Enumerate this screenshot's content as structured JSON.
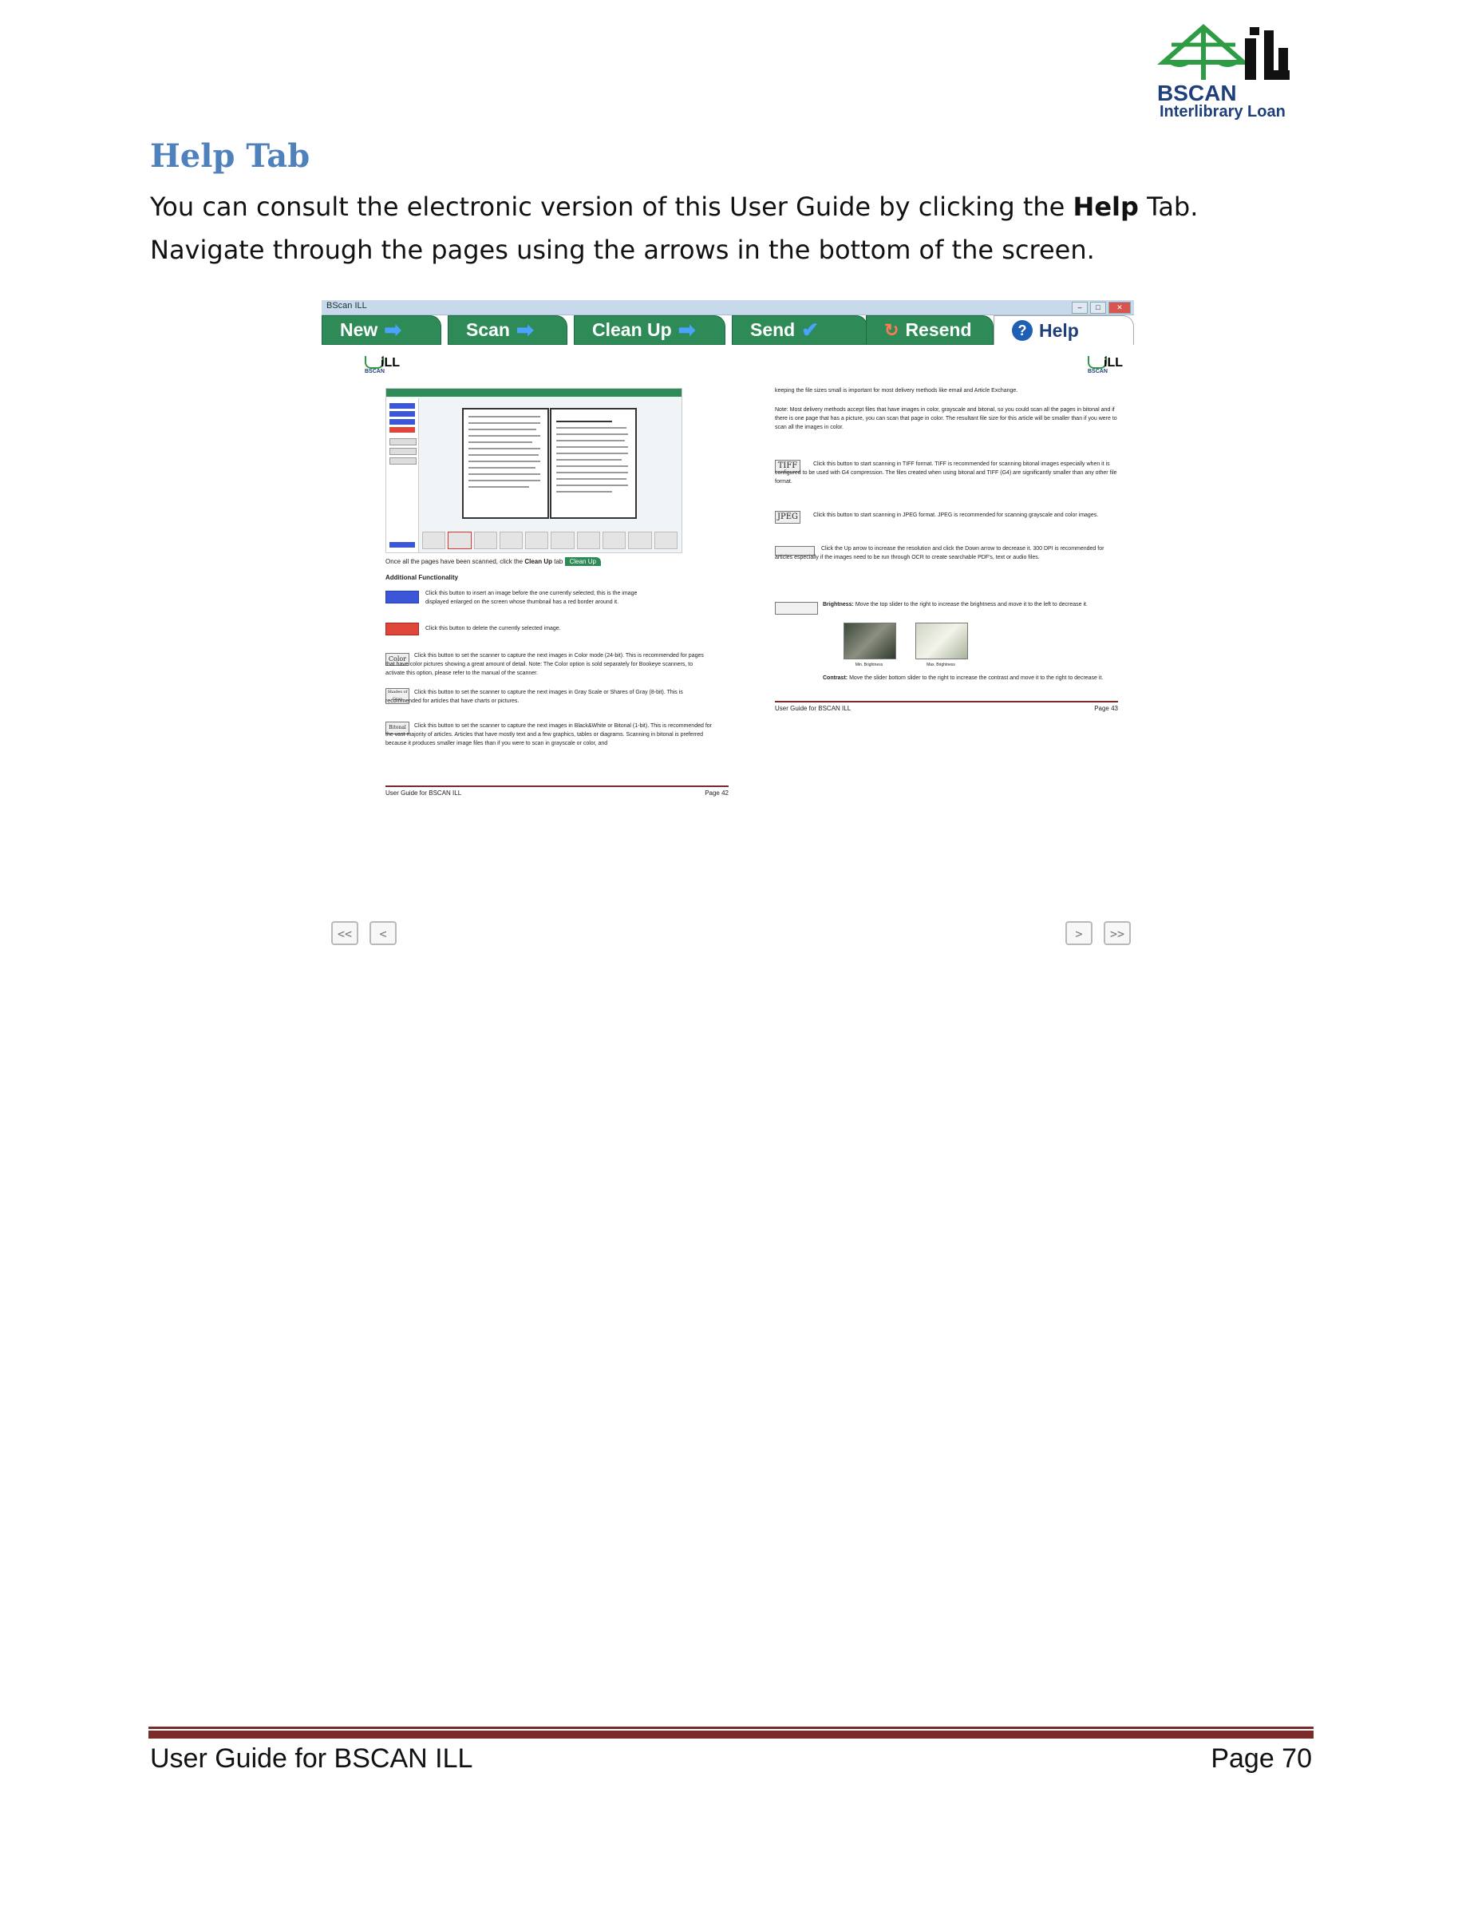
{
  "logo": {
    "brand": "BSCAN",
    "mark": "iLL",
    "subtitle": "Interlibrary Loan"
  },
  "heading": "Help Tab",
  "intro": {
    "before": "You can consult the electronic version of this User Guide by clicking the ",
    "bold": "Help",
    "after": " Tab.  Navigate through the pages using the arrows in the bottom of the screen."
  },
  "app": {
    "window_title": "BScan ILL",
    "tabs": [
      {
        "label": "New"
      },
      {
        "label": "Scan"
      },
      {
        "label": "Clean Up"
      },
      {
        "label": "Send"
      },
      {
        "label": "Resend"
      },
      {
        "label": "Help"
      }
    ],
    "left_page": {
      "caption_before": "Once all the pages have been scanned, click the ",
      "caption_bold": "Clean Up",
      "caption_after": " tab",
      "mini_tab": "Clean Up",
      "section_title": "Additional Functionality",
      "insert_text": "Click this button to insert an image before the one currently selected; this is the image displayed enlarged on the screen whose thumbnail has a red border around it.",
      "delete_text": "Click this button to delete the currently selected image.",
      "color_label": "Color",
      "color_text": "Click this button to set the scanner to capture the next images in Color mode (24-bit).  This is recommended for pages that have color pictures showing a great amount of detail.  Note: The Color option is sold separately for Bookeye scanners, to activate this option, please refer to the manual of the scanner.",
      "gray_label": "Shades of Gray",
      "gray_text": "Click this button to set the scanner to capture the next images in Gray Scale or Shares of Gray (8-bit).  This is recommended for articles that have charts or pictures.",
      "bitonal_label": "Bitonal",
      "bitonal_text": "Click this button to set the scanner to capture the next images in Black&White or Bitonal (1-bit).  This is recommended for the vast majority of articles.  Articles that have mostly text and a few graphics, tables or diagrams.  Scanning in bitonal is preferred because it produces smaller image files than if you were to scan in grayscale or color, and",
      "footer_left": "User Guide for BSCAN ILL",
      "footer_right": "Page 42"
    },
    "right_page": {
      "p1": "keeping the file sizes small is important for most delivery methods like email and Article Exchange.",
      "p2": "Note: Most delivery methods accept files that have images in color, grayscale and bitonal, so you could scan all the pages in bitonal and if there is one page that has a picture, you can scan that page in color.  The resultant file size for this article will be smaller than if you were to scan all the images in color.",
      "tiff_label": "TIFF",
      "tiff_text": "Click this button to start scanning in TIFF format.  TIFF is recommended for scanning bitonal images especially when it is configured to be used with G4 compression.  The files created when using bitonal and TIFF (G4) are significantly smaller than any other file format.",
      "jpeg_label": "JPEG",
      "jpeg_text": "Click this button to start scanning in JPEG format.  JPEG is recommended for scanning grayscale and color images.",
      "res_text": "Click the Up arrow to increase the resolution and click the Down arrow to decrease it.  300 DPI is recommended for articles especially if the images need to be run through OCR to create searchable PDF's, text or audio files.",
      "brightness_bold": "Brightness:",
      "brightness_text": " Move the top slider to the right to increase the brightness and move it to the left to decrease it.",
      "min_caption": "Min. Brightness",
      "max_caption": "Max. Brightness",
      "contrast_bold": "Contrast:",
      "contrast_text": " Move the slider bottom  slider to the right to increase the contrast and move it to the right to decrease it.",
      "footer_left": "User Guide for BSCAN ILL",
      "footer_right": "Page 43"
    },
    "nav": {
      "first": "<<",
      "prev": "<",
      "next": ">",
      "last": ">>"
    }
  },
  "footer": {
    "left": "User Guide for BSCAN ILL",
    "right": "Page 70"
  },
  "colors": {
    "heading": "#4f81bd",
    "tab_green": "#2e8b57",
    "footer_rule": "#7b2a2a",
    "logo_green": "#2e9b45",
    "logo_blue": "#1f3f7a"
  },
  "icons": [
    "scale-of-justice-icon",
    "arrow-right-icon",
    "check-icon",
    "resend-icon",
    "help-icon"
  ]
}
